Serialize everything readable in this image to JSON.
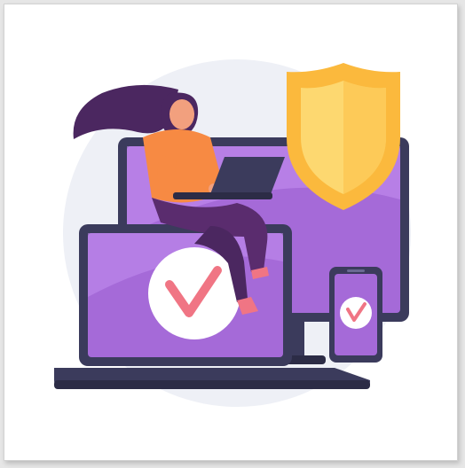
{
  "illustration": {
    "subject": "secure-devices",
    "icons": [
      "shield-icon",
      "checkmark-icon",
      "laptop-icon",
      "monitor-icon",
      "smartphone-icon"
    ],
    "colors": {
      "background_circle": "#eef0f6",
      "monitor_frame": "#3b3b5c",
      "screen_purple": "#a56ad8",
      "screen_highlight": "#c38ef0",
      "shield_outer": "#fbb93d",
      "shield_inner": "#fdd870",
      "checkmark": "#f07584",
      "woman_hair": "#4b2760",
      "woman_top": "#f78a43",
      "woman_pants": "#5a2c6e",
      "skin": "#f2a07e"
    }
  }
}
